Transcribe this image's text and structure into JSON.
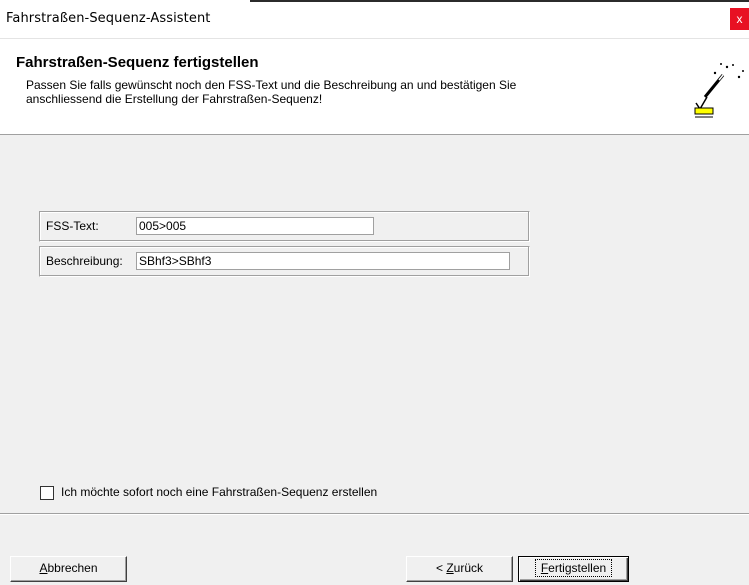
{
  "window": {
    "title": "Fahrstraßen-Sequenz-Assistent",
    "close_label": "x"
  },
  "header": {
    "title": "Fahrstraßen-Sequenz fertigstellen",
    "description_line1": "Passen Sie falls gewünscht noch den FSS-Text und die Beschreibung an und bestätigen Sie",
    "description_line2": "anschliessend die Erstellung der Fahrstraßen-Sequenz!",
    "icon": "magic-wand-icon"
  },
  "form": {
    "fss_text_label": "FSS-Text:",
    "fss_text_value": "005>005",
    "beschreibung_label": "Beschreibung:",
    "beschreibung_value": "SBhf3>SBhf3"
  },
  "options": {
    "create_another_label": "Ich möchte sofort noch eine Fahrstraßen-Sequenz erstellen",
    "create_another_checked": false
  },
  "buttons": {
    "cancel_accel": "A",
    "cancel_rest": "bbrechen",
    "back_prefix": "< ",
    "back_accel": "Z",
    "back_rest": "urück",
    "finish_accel": "F",
    "finish_rest": "ertigstellen"
  }
}
